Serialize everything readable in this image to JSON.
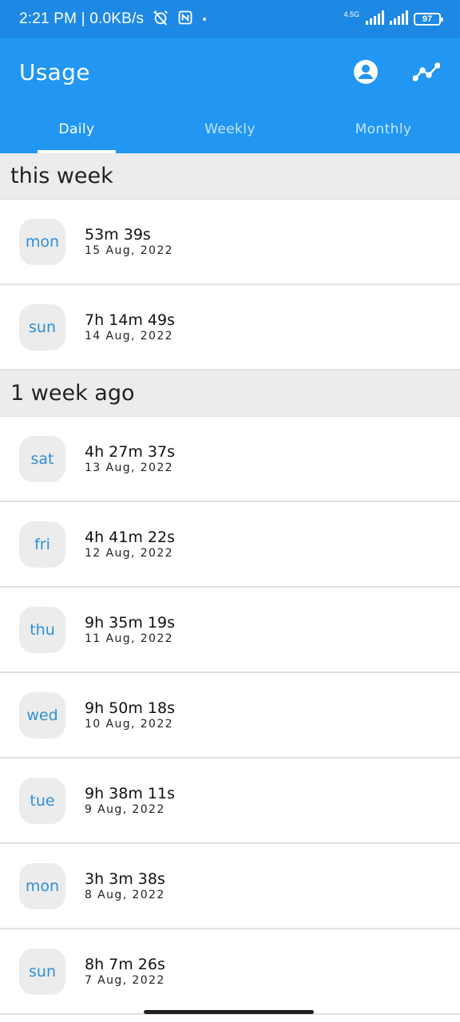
{
  "status_bar": {
    "time_text": "2:21 PM | 0.0KB/s",
    "network_label": "4.5G",
    "battery": "97"
  },
  "app_bar": {
    "title": "Usage",
    "icons": [
      "account-circle-icon",
      "trend-chart-icon"
    ]
  },
  "tabs": [
    {
      "label": "Daily",
      "active": true
    },
    {
      "label": "Weekly",
      "active": false
    },
    {
      "label": "Monthly",
      "active": false
    }
  ],
  "sections": [
    {
      "header": "this week",
      "items": [
        {
          "day": "mon",
          "duration": "53m 39s",
          "date": "15 Aug, 2022"
        },
        {
          "day": "sun",
          "duration": "7h 14m 49s",
          "date": "14 Aug, 2022"
        }
      ]
    },
    {
      "header": "1 week ago",
      "items": [
        {
          "day": "sat",
          "duration": "4h 27m 37s",
          "date": "13 Aug, 2022"
        },
        {
          "day": "fri",
          "duration": "4h 41m 22s",
          "date": "12 Aug, 2022"
        },
        {
          "day": "thu",
          "duration": "9h 35m 19s",
          "date": "11 Aug, 2022"
        },
        {
          "day": "wed",
          "duration": "9h 50m 18s",
          "date": "10 Aug, 2022"
        },
        {
          "day": "tue",
          "duration": "9h 38m 11s",
          "date": "9 Aug, 2022"
        },
        {
          "day": "mon",
          "duration": "3h 3m 38s",
          "date": "8 Aug, 2022"
        },
        {
          "day": "sun",
          "duration": "8h 7m 26s",
          "date": "7 Aug, 2022"
        }
      ]
    }
  ],
  "colors": {
    "status_bar": "#1e88e5",
    "app_bar": "#2196f3",
    "day_text": "#2e8fd8",
    "badge_bg": "#ececec"
  }
}
